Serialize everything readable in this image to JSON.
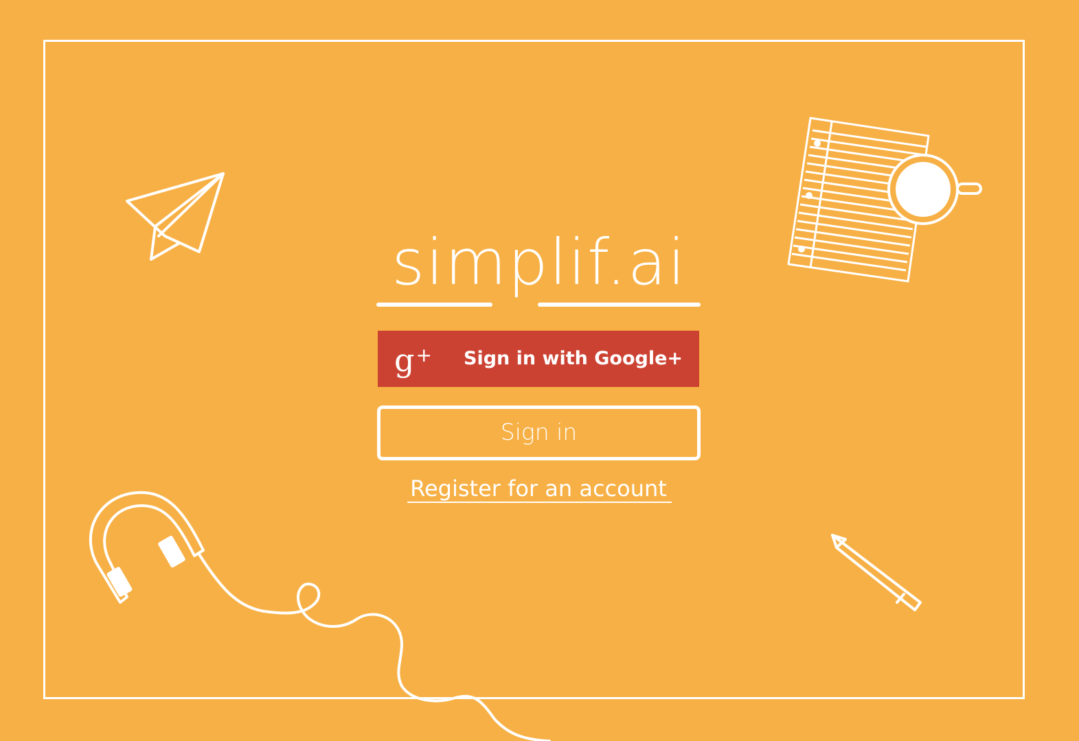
{
  "app": {
    "brand_name": "simplif.ai"
  },
  "auth": {
    "google_button_label": "Sign in with Google+",
    "google_icon_glyph": "g",
    "google_icon_plus": "+",
    "signin_button_label": "Sign in",
    "register_link_label": "Register for an account"
  },
  "theme": {
    "background": "#F7B045",
    "google_red": "#CC4232",
    "line_color": "#FFFFFF"
  },
  "decorations": {
    "icons": [
      "paper-plane-icon",
      "notepad-icon",
      "coffee-cup-icon",
      "headphones-icon",
      "pencil-icon"
    ]
  }
}
